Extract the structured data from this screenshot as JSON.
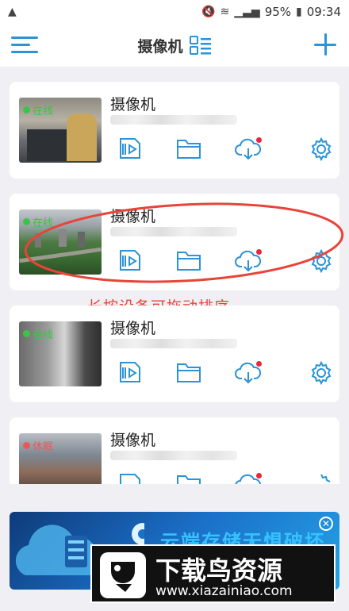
{
  "status_bar": {
    "battery": "95%",
    "time": "09:34"
  },
  "appbar": {
    "title": "摄像机"
  },
  "cameras": [
    {
      "name": "摄像机",
      "status": "在线",
      "status_color": "#3cc447"
    },
    {
      "name": "摄像机",
      "status": "在线",
      "status_color": "#3cc447"
    },
    {
      "name": "摄像机",
      "status": "在线",
      "status_color": "#3cc447"
    },
    {
      "name": "摄像机",
      "status": "休眠",
      "status_color": "#e85a5a"
    }
  ],
  "annotation": {
    "text": "长按设备可拖动排序"
  },
  "ad": {
    "text": "云端存储无惧破坏"
  },
  "watermark": {
    "title": "下载鸟资源",
    "url": "www.xiazainiao.com"
  },
  "colors": {
    "accent": "#2b93d6",
    "notify": "#e5283d"
  }
}
